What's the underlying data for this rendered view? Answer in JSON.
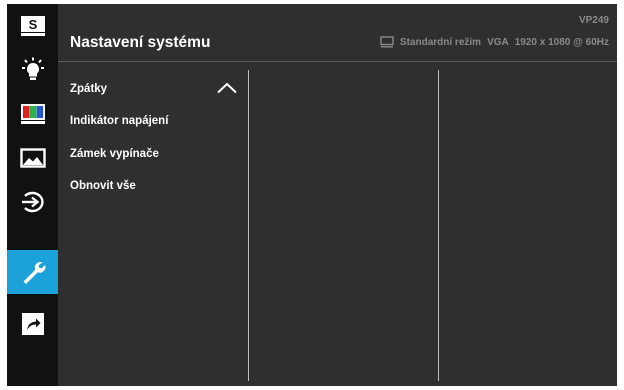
{
  "header": {
    "title": "Nastavení systému",
    "model": "VP249",
    "status": {
      "mode": "Standardní režim",
      "input": "VGA",
      "resolution": "1920 x 1080 @ 60Hz"
    }
  },
  "sidebar": {
    "items": [
      {
        "name": "splendid-icon",
        "label": "S"
      },
      {
        "name": "blue-light-icon"
      },
      {
        "name": "color-icon"
      },
      {
        "name": "image-icon"
      },
      {
        "name": "input-select-icon"
      },
      {
        "name": "system-setup-icon",
        "active": true
      },
      {
        "name": "shortcut-icon"
      }
    ]
  },
  "menu": {
    "items": [
      {
        "label": "Zpátky"
      },
      {
        "label": "Indikátor napájení"
      },
      {
        "label": "Zámek vypínače"
      },
      {
        "label": "Obnovit vše"
      }
    ]
  },
  "colors": {
    "accent": "#1da1d9",
    "panel": "#2f2f2f",
    "sidebar": "#111111",
    "text": "#ffffff",
    "muted": "#8a8a8a"
  }
}
